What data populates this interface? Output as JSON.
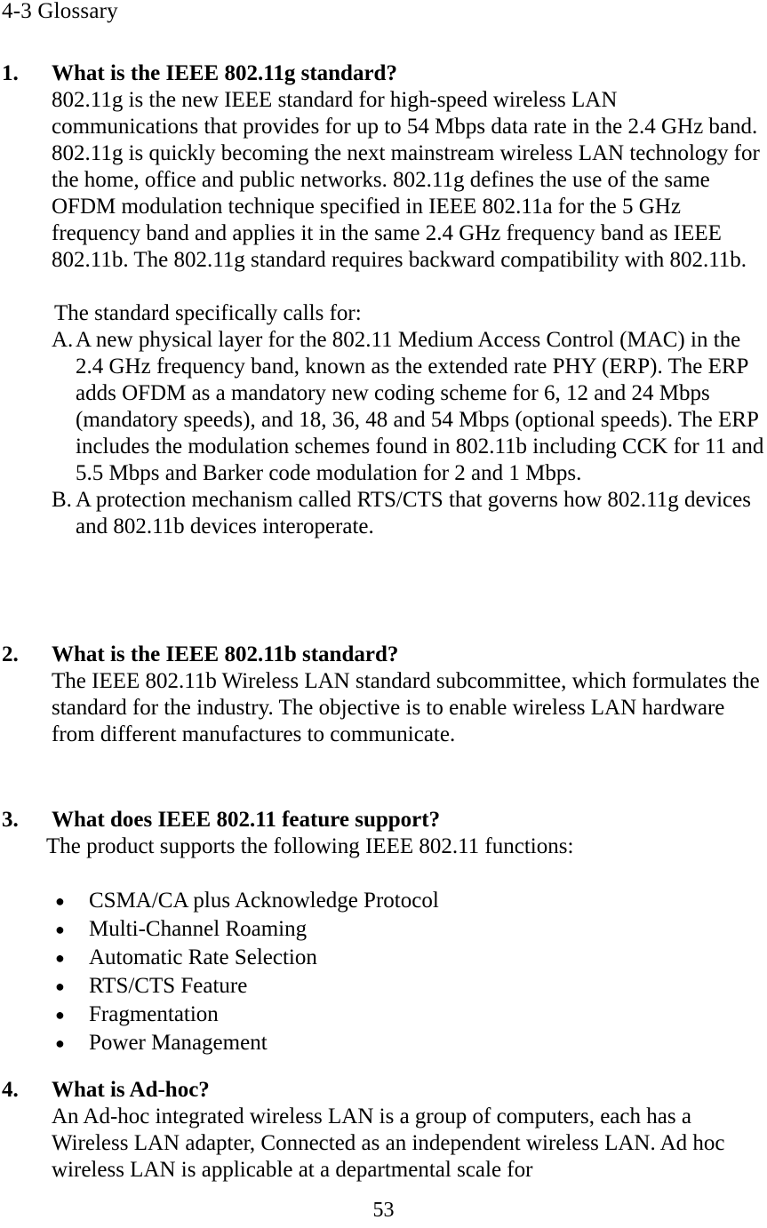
{
  "document": {
    "running_header": "4-3 Glossary",
    "page_number": "53"
  },
  "sections": [
    {
      "number": "1.",
      "heading": "What is the IEEE 802.11g standard?",
      "body": "802.11g is the new IEEE standard for high-speed wireless LAN communications that provides for up to 54 Mbps data rate in the 2.4 GHz band. 802.11g is quickly becoming the next mainstream wireless LAN technology for the home, office and public networks. 802.11g defines the use of the same OFDM modulation technique specified in IEEE 802.11a for the 5 GHz frequency band and applies it in the same 2.4 GHz frequency band as IEEE 802.11b. The 802.11g standard requires backward compatibility with 802.11b.",
      "lead_in": "The standard specifically calls for:",
      "letter_items": [
        {
          "marker": "A.",
          "text": "A new physical layer for the 802.11 Medium Access Control (MAC) in the 2.4 GHz frequency band, known as the extended rate PHY (ERP). The ERP adds OFDM as a mandatory new coding scheme for 6, 12 and 24 Mbps (mandatory speeds), and 18, 36, 48 and 54 Mbps (optional speeds). The ERP includes the modulation schemes found in 802.11b including CCK for 11 and 5.5 Mbps and Barker code modulation for 2 and 1 Mbps."
        },
        {
          "marker": "B.",
          "text": "A protection mechanism called RTS/CTS that governs how 802.11g devices and 802.11b devices interoperate."
        }
      ]
    },
    {
      "number": "2.",
      "heading": "What is the IEEE 802.11b standard?",
      "body": "The IEEE 802.11b Wireless LAN standard subcommittee, which formulates the standard for the industry. The objective is to enable wireless LAN hardware from different manufactures to communicate."
    },
    {
      "number": "3.",
      "heading": "What does IEEE 802.11 feature support?",
      "body": "The product supports the following IEEE 802.11 functions:",
      "bullets": [
        "CSMA/CA plus Acknowledge Protocol",
        "Multi-Channel Roaming",
        "Automatic Rate Selection",
        "RTS/CTS Feature",
        "Fragmentation",
        "Power Management"
      ]
    },
    {
      "number": "4.",
      "heading": "What is Ad-hoc?",
      "body": "An Ad-hoc integrated wireless LAN is a group of computers, each has a Wireless LAN adapter, Connected as an independent wireless LAN. Ad hoc wireless LAN is applicable at a departmental scale for"
    }
  ],
  "icons": {
    "bullet": "●"
  }
}
